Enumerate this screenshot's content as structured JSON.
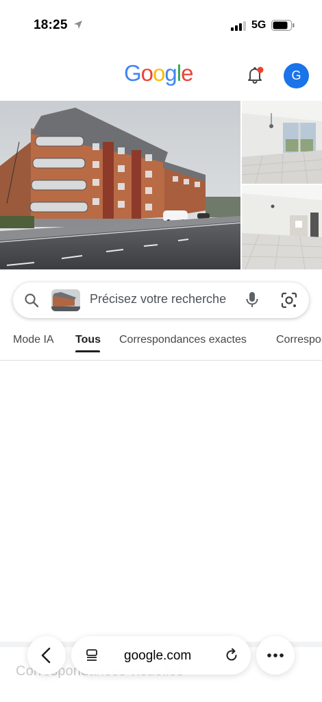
{
  "status_bar": {
    "time": "18:25",
    "network": "5G",
    "icons": [
      "location-arrow-icon",
      "signal-icon",
      "battery-icon"
    ]
  },
  "header": {
    "logo_letters": [
      {
        "char": "G",
        "color": "#4285F4"
      },
      {
        "char": "o",
        "color": "#EA4335"
      },
      {
        "char": "o",
        "color": "#FBBC05"
      },
      {
        "char": "g",
        "color": "#4285F4"
      },
      {
        "char": "l",
        "color": "#34A853"
      },
      {
        "char": "e",
        "color": "#EA4335"
      }
    ],
    "avatar_initial": "G",
    "avatar_color": "#1a73e8",
    "notification_dot_color": "#EA4335"
  },
  "images": {
    "main": "apartment-building-photo",
    "side_top": "living-room-window-photo",
    "side_bottom": "empty-room-tiled-floor-photo"
  },
  "search": {
    "placeholder": "Précisez votre recherche",
    "icons": [
      "search-icon",
      "query-image-thumbnail",
      "mic-icon",
      "lens-icon"
    ]
  },
  "tabs": [
    {
      "label": "Mode IA",
      "active": false
    },
    {
      "label": "Tous",
      "active": true
    },
    {
      "label": "Correspondances exactes",
      "active": false
    },
    {
      "label": "Correspondances",
      "active": false
    }
  ],
  "section_heading": "Correspondances visuelles",
  "browser": {
    "url": "google.com",
    "icons": [
      "back-chevron-icon",
      "reader-icon",
      "reload-icon",
      "more-icon"
    ]
  }
}
